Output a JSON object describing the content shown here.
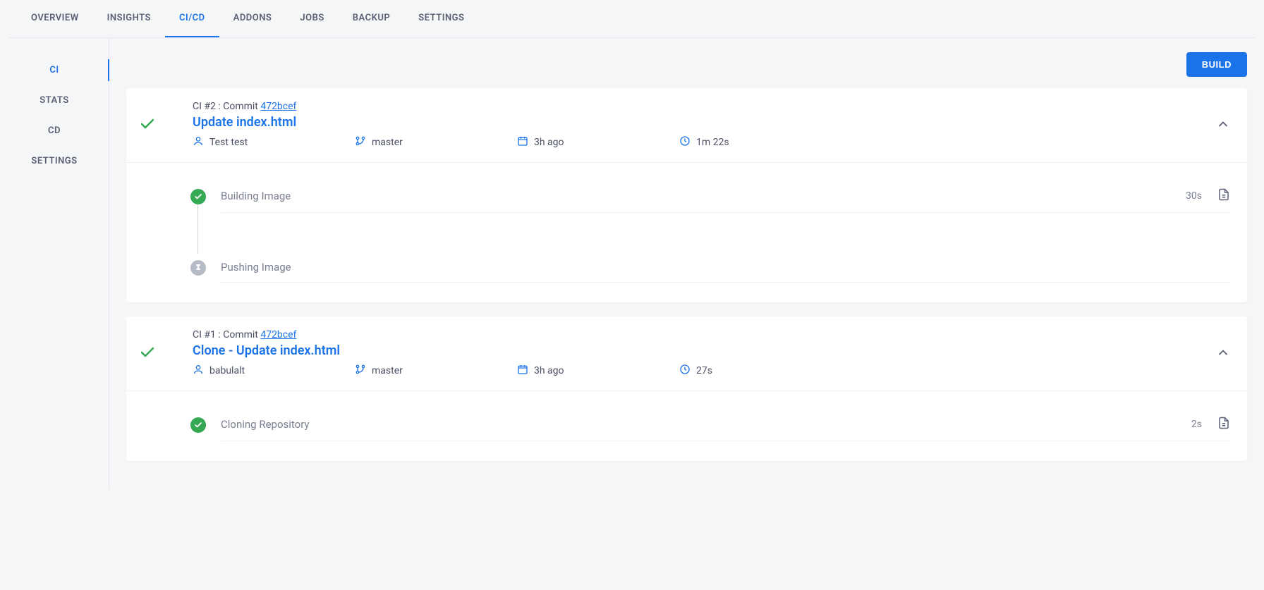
{
  "topnav": {
    "items": [
      {
        "label": "OVERVIEW"
      },
      {
        "label": "INSIGHTS"
      },
      {
        "label": "CI/CD"
      },
      {
        "label": "ADDONS"
      },
      {
        "label": "JOBS"
      },
      {
        "label": "BACKUP"
      },
      {
        "label": "SETTINGS"
      }
    ],
    "active_index": 2
  },
  "sidenav": {
    "items": [
      {
        "label": "CI"
      },
      {
        "label": "STATS"
      },
      {
        "label": "CD"
      },
      {
        "label": "SETTINGS"
      }
    ],
    "active_index": 0
  },
  "toolbar": {
    "build_label": "BUILD"
  },
  "builds": [
    {
      "meta_prefix": "CI #2 : Commit ",
      "commit_hash": "472bcef",
      "title": "Update index.html",
      "author": "Test test",
      "branch": "master",
      "time_ago": "3h ago",
      "duration": "1m 22s",
      "steps": [
        {
          "name": "Building Image",
          "duration": "30s",
          "status": "success"
        },
        {
          "name": "Pushing Image",
          "duration": "",
          "status": "queued"
        }
      ]
    },
    {
      "meta_prefix": "CI #1 : Commit ",
      "commit_hash": "472bcef",
      "title": "Clone - Update index.html",
      "author": "babulalt",
      "branch": "master",
      "time_ago": "3h ago",
      "duration": "27s",
      "steps": [
        {
          "name": "Cloning Repository",
          "duration": "2s",
          "status": "success"
        }
      ]
    }
  ]
}
